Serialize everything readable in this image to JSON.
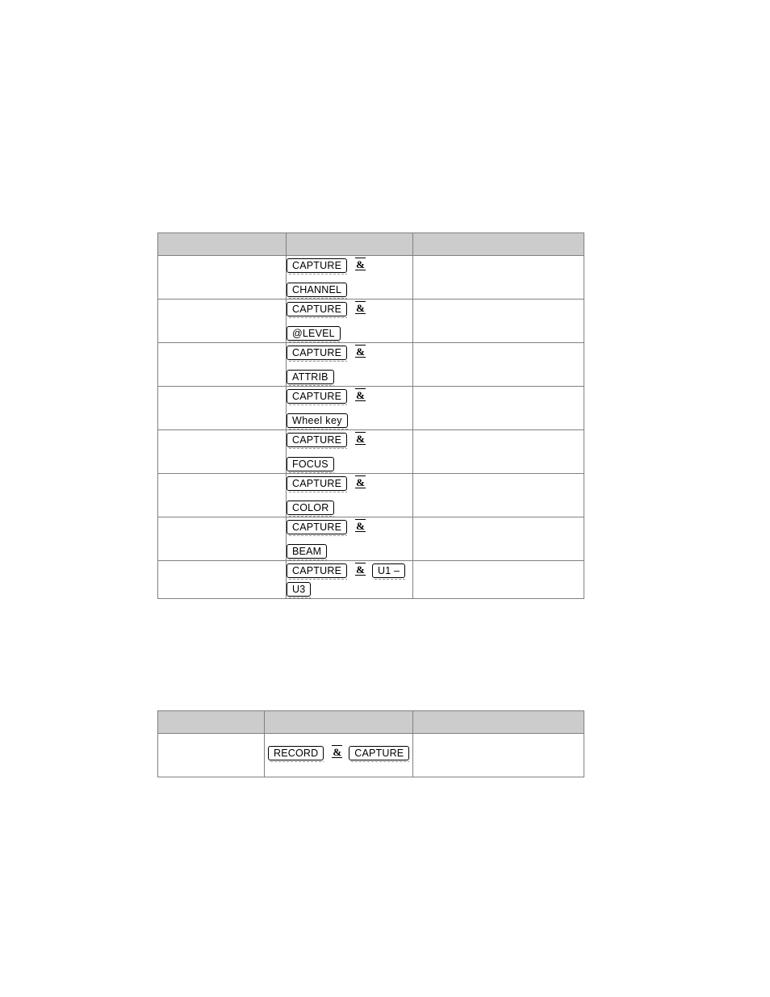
{
  "page": {
    "background_color": "#ffffff",
    "header_fill_color": "#cccccc",
    "border_color": "#808080",
    "keycap_border_color": "#000000",
    "keycap_shadow_color": "#9a9a9a"
  },
  "joiner": {
    "label": "&"
  },
  "tables": [
    {
      "id": "table-shortcuts-capture",
      "name": "capture-shortcuts-table",
      "headers": [
        "",
        "",
        ""
      ],
      "rows": [
        {
          "action": "",
          "description": "",
          "key_lines": [
            {
              "keys": [
                "CAPTURE"
              ],
              "joiner_after": true
            },
            {
              "keys": [
                "CHANNEL"
              ],
              "joiner_after": false
            }
          ]
        },
        {
          "action": "",
          "description": "",
          "key_lines": [
            {
              "keys": [
                "CAPTURE"
              ],
              "joiner_after": true
            },
            {
              "keys": [
                "@LEVEL"
              ],
              "joiner_after": false
            }
          ]
        },
        {
          "action": "",
          "description": "",
          "key_lines": [
            {
              "keys": [
                "CAPTURE"
              ],
              "joiner_after": true
            },
            {
              "keys": [
                "ATTRIB"
              ],
              "joiner_after": false
            }
          ]
        },
        {
          "action": "",
          "description": "",
          "key_lines": [
            {
              "keys": [
                "CAPTURE"
              ],
              "joiner_after": true
            },
            {
              "keys": [
                "Wheel key"
              ],
              "joiner_after": false
            }
          ]
        },
        {
          "action": "",
          "description": "",
          "key_lines": [
            {
              "keys": [
                "CAPTURE"
              ],
              "joiner_after": true
            },
            {
              "keys": [
                "FOCUS"
              ],
              "joiner_after": false
            }
          ]
        },
        {
          "action": "",
          "description": "",
          "key_lines": [
            {
              "keys": [
                "CAPTURE"
              ],
              "joiner_after": true
            },
            {
              "keys": [
                "COLOR"
              ],
              "joiner_after": false
            }
          ]
        },
        {
          "action": "",
          "description": "",
          "key_lines": [
            {
              "keys": [
                "CAPTURE"
              ],
              "joiner_after": true
            },
            {
              "keys": [
                "BEAM"
              ],
              "joiner_after": false
            }
          ]
        },
        {
          "action": "",
          "description": "",
          "wrapping": true,
          "key_lines": [
            {
              "keys": [
                "CAPTURE"
              ],
              "joiner_after": true,
              "trailing_keys": [
                "U1 –",
                "U3"
              ]
            }
          ]
        }
      ]
    },
    {
      "id": "table-shortcuts-record",
      "name": "record-shortcuts-table",
      "headers": [
        "",
        "",
        ""
      ],
      "rows": [
        {
          "action": "",
          "description": "",
          "inline": true,
          "key_lines": [
            {
              "keys": [
                "RECORD"
              ],
              "joiner_after": true,
              "trailing_keys": [
                "CAPTURE"
              ]
            }
          ]
        }
      ]
    }
  ]
}
